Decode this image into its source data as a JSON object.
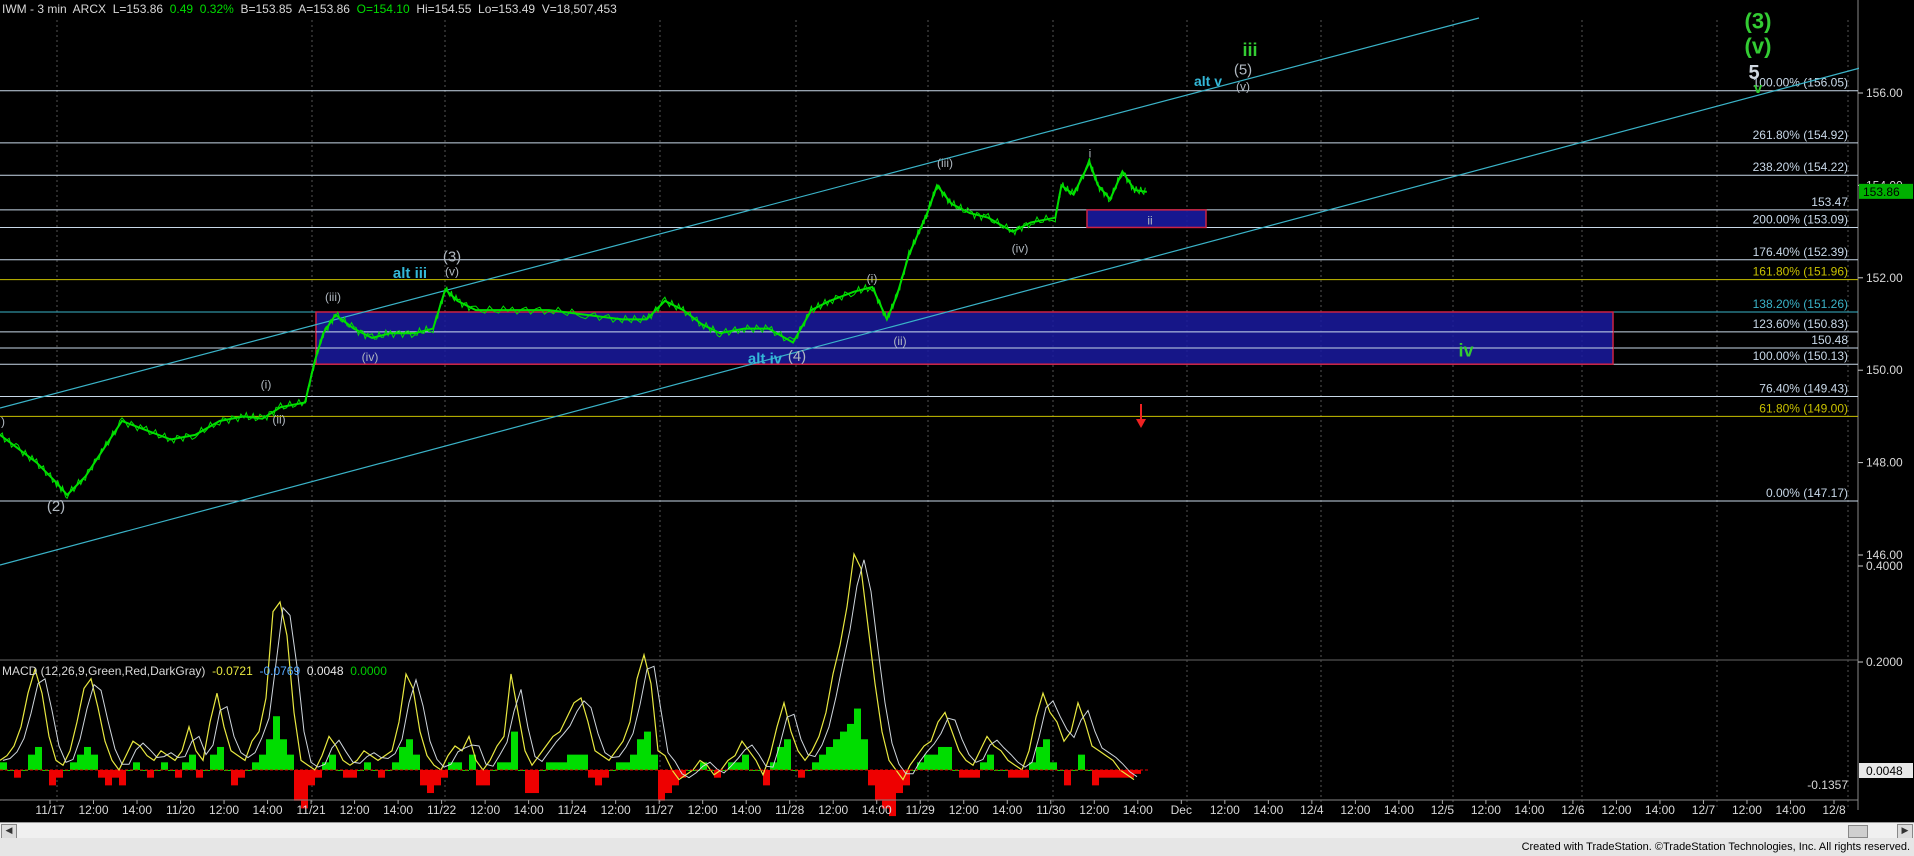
{
  "header": {
    "symbol": "IWM - 3 min  ARCX",
    "last": "L=153.86",
    "chg": "0.49",
    "chg_pct": "0.32%",
    "bid": "B=153.85",
    "ask": "A=153.86",
    "open": "O=154.10",
    "hi": "Hi=154.55",
    "lo": "Lo=153.49",
    "vol": "V=18,507,453"
  },
  "macd_header": {
    "label": "MACD (12,26,9,Green,Red,DarkGray)",
    "v1": "-0.0721",
    "v2": "-0.0769",
    "v3": "0.0048",
    "v4": "0.0000"
  },
  "colors": {
    "background": "#000000",
    "price": "#00e000",
    "channel": "#3ab3c8",
    "fib_line": "#c8d8e8",
    "box_fill": "#1a1aa0",
    "box_border": "#cc2244",
    "green_label": "#33cc33",
    "cyan_label": "#33b8d8",
    "gray_label": "#b0b8c0",
    "macd_line": "#e8e8e8",
    "signal_line": "#e8e840",
    "hist_pos": "#00dd00",
    "hist_neg": "#ee0000",
    "last_price_bg": "#00b000"
  },
  "chart_data": {
    "type": "line",
    "title": "IWM - 3 min  ARCX",
    "price_axis": {
      "min": 144,
      "max": 157.5,
      "ticks": [
        "156.00",
        "154.00",
        "152.00",
        "150.00",
        "148.00",
        "146.00"
      ]
    },
    "macd_axis": {
      "min": -0.2,
      "max": 0.55,
      "ticks": [
        "0.4000",
        "0.2000"
      ],
      "last_label": "-0.1357"
    },
    "x_ticks": [
      "11/17",
      "12:00",
      "14:00",
      "11/20",
      "12:00",
      "14:00",
      "11/21",
      "12:00",
      "14:00",
      "11/22",
      "12:00",
      "14:00",
      "11/24",
      "12:00",
      "11/27",
      "12:00",
      "14:00",
      "11/28",
      "12:00",
      "14:00",
      "11/29",
      "12:00",
      "14:00",
      "11/30",
      "12:00",
      "14:00",
      "Dec",
      "12:00",
      "14:00",
      "12/4",
      "12:00",
      "14:00",
      "12/5",
      "12:00",
      "14:00",
      "12/6",
      "12:00",
      "14:00",
      "12/7",
      "12:00",
      "14:00",
      "12/8"
    ],
    "last_price": "153.86",
    "last_macd": "0.0048",
    "price_series": [
      {
        "x": 0,
        "y": 148.6
      },
      {
        "x": 15,
        "y": 148.3
      },
      {
        "x": 30,
        "y": 148.0
      },
      {
        "x": 45,
        "y": 147.6
      },
      {
        "x": 55,
        "y": 147.3
      },
      {
        "x": 70,
        "y": 147.7
      },
      {
        "x": 85,
        "y": 148.3
      },
      {
        "x": 100,
        "y": 148.9
      },
      {
        "x": 120,
        "y": 148.7
      },
      {
        "x": 140,
        "y": 148.5
      },
      {
        "x": 160,
        "y": 148.6
      },
      {
        "x": 180,
        "y": 148.9
      },
      {
        "x": 200,
        "y": 149.0
      },
      {
        "x": 215,
        "y": 148.95
      },
      {
        "x": 230,
        "y": 149.2
      },
      {
        "x": 250,
        "y": 149.3
      },
      {
        "x": 258,
        "y": 150.2
      },
      {
        "x": 265,
        "y": 150.8
      },
      {
        "x": 275,
        "y": 151.2
      },
      {
        "x": 290,
        "y": 150.9
      },
      {
        "x": 305,
        "y": 150.7
      },
      {
        "x": 320,
        "y": 150.8
      },
      {
        "x": 340,
        "y": 150.8
      },
      {
        "x": 355,
        "y": 150.9
      },
      {
        "x": 365,
        "y": 151.75
      },
      {
        "x": 375,
        "y": 151.5
      },
      {
        "x": 390,
        "y": 151.3
      },
      {
        "x": 420,
        "y": 151.3
      },
      {
        "x": 450,
        "y": 151.3
      },
      {
        "x": 480,
        "y": 151.2
      },
      {
        "x": 510,
        "y": 151.1
      },
      {
        "x": 530,
        "y": 151.1
      },
      {
        "x": 545,
        "y": 151.5
      },
      {
        "x": 560,
        "y": 151.3
      },
      {
        "x": 575,
        "y": 151.0
      },
      {
        "x": 590,
        "y": 150.8
      },
      {
        "x": 610,
        "y": 150.9
      },
      {
        "x": 630,
        "y": 150.9
      },
      {
        "x": 650,
        "y": 150.6
      },
      {
        "x": 665,
        "y": 151.3
      },
      {
        "x": 680,
        "y": 151.5
      },
      {
        "x": 700,
        "y": 151.7
      },
      {
        "x": 715,
        "y": 151.8
      },
      {
        "x": 727,
        "y": 151.1
      },
      {
        "x": 735,
        "y": 151.6
      },
      {
        "x": 745,
        "y": 152.5
      },
      {
        "x": 755,
        "y": 153.1
      },
      {
        "x": 760,
        "y": 153.4
      },
      {
        "x": 768,
        "y": 154.0
      },
      {
        "x": 780,
        "y": 153.6
      },
      {
        "x": 795,
        "y": 153.4
      },
      {
        "x": 810,
        "y": 153.3
      },
      {
        "x": 830,
        "y": 153.0
      },
      {
        "x": 845,
        "y": 153.2
      },
      {
        "x": 865,
        "y": 153.3
      },
      {
        "x": 870,
        "y": 154.0
      },
      {
        "x": 880,
        "y": 153.8
      },
      {
        "x": 893,
        "y": 154.5
      },
      {
        "x": 900,
        "y": 154.0
      },
      {
        "x": 910,
        "y": 153.7
      },
      {
        "x": 920,
        "y": 154.3
      },
      {
        "x": 930,
        "y": 153.9
      },
      {
        "x": 940,
        "y": 153.86
      }
    ]
  },
  "fib_levels": [
    {
      "price": 156.05,
      "label": "100.00% (156.05)",
      "color": "#c8d8e8"
    },
    {
      "price": 154.92,
      "label": "261.80% (154.92)",
      "color": "#c8d8e8"
    },
    {
      "price": 154.22,
      "label": "238.20% (154.22)",
      "color": "#c8d8e8"
    },
    {
      "price": 153.47,
      "label": "153.47",
      "color": "#c8d8e8"
    },
    {
      "price": 153.09,
      "label": "200.00% (153.09)",
      "color": "#c8d8e8"
    },
    {
      "price": 152.39,
      "label": "176.40% (152.39)",
      "color": "#c8d8e8"
    },
    {
      "price": 151.96,
      "label": "161.80% (151.96)",
      "color": "#c8c000"
    },
    {
      "price": 151.26,
      "label": "138.20% (151.26)",
      "color": "#3ab3c8"
    },
    {
      "price": 150.83,
      "label": "123.60% (150.83)",
      "color": "#c8d8e8"
    },
    {
      "price": 150.48,
      "label": "150.48",
      "color": "#c8d8e8"
    },
    {
      "price": 150.13,
      "label": "100.00% (150.13)",
      "color": "#c8d8e8"
    },
    {
      "price": 149.43,
      "label": "76.40% (149.43)",
      "color": "#c8d8e8"
    },
    {
      "price": 149.0,
      "label": "61.80% (149.00)",
      "color": "#c8c000"
    },
    {
      "price": 147.17,
      "label": "0.00% (147.17)",
      "color": "#c8d8e8"
    }
  ],
  "wave_labels": [
    {
      "t": "(3)",
      "p": 157.4,
      "x": 1758,
      "c": "#33cc33",
      "s": 22
    },
    {
      "t": "(v)",
      "p": 156.85,
      "x": 1758,
      "c": "#33cc33",
      "s": 22
    },
    {
      "t": "5",
      "p": 156.3,
      "x": 1754,
      "c": "#d0d8e0",
      "s": 20
    },
    {
      "t": "v",
      "p": 156.0,
      "x": 1758,
      "c": "#33cc33",
      "s": 15
    },
    {
      "t": "iii",
      "p": 156.8,
      "x": 1250,
      "c": "#33cc33",
      "s": 18
    },
    {
      "t": "(5)",
      "p": 156.4,
      "x": 1243,
      "c": "#b0b8c0",
      "s": 15
    },
    {
      "t": "(v)",
      "p": 156.05,
      "x": 1243,
      "c": "#b0b8c0",
      "s": 12
    },
    {
      "t": "alt v",
      "p": 156.15,
      "x": 1208,
      "c": "#33b8d8",
      "s": 14
    },
    {
      "t": "i",
      "p": 154.6,
      "x": 1090,
      "c": "#b0b8c0",
      "s": 12
    },
    {
      "t": "(iii)",
      "p": 154.4,
      "x": 945,
      "c": "#b0b8c0",
      "s": 12
    },
    {
      "t": "ii",
      "p": 153.15,
      "x": 1150,
      "c": "#b0b8c0",
      "s": 12
    },
    {
      "t": "(iv)",
      "p": 152.55,
      "x": 1020,
      "c": "#b0b8c0",
      "s": 12
    },
    {
      "t": "(i)",
      "p": 151.9,
      "x": 872,
      "c": "#b0b8c0",
      "s": 12
    },
    {
      "t": "(ii)",
      "p": 150.55,
      "x": 900,
      "c": "#b0b8c0",
      "s": 12
    },
    {
      "t": "alt iii",
      "p": 152.0,
      "x": 410,
      "c": "#33b8d8",
      "s": 15
    },
    {
      "t": "(3)",
      "p": 152.35,
      "x": 452,
      "c": "#b0b8c0",
      "s": 15
    },
    {
      "t": "(v)",
      "p": 152.05,
      "x": 452,
      "c": "#b0b8c0",
      "s": 12
    },
    {
      "t": "(iii)",
      "p": 151.5,
      "x": 333,
      "c": "#b0b8c0",
      "s": 12
    },
    {
      "t": "(iv)",
      "p": 150.2,
      "x": 370,
      "c": "#b0b8c0",
      "s": 12
    },
    {
      "t": "alt iv",
      "p": 150.15,
      "x": 765,
      "c": "#33b8d8",
      "s": 15
    },
    {
      "t": "(4)",
      "p": 150.2,
      "x": 797,
      "c": "#b0b8c0",
      "s": 15
    },
    {
      "t": "iv",
      "p": 150.3,
      "x": 1466,
      "c": "#33cc33",
      "s": 18
    },
    {
      "t": "(i)",
      "p": 149.6,
      "x": 266,
      "c": "#b0b8c0",
      "s": 12
    },
    {
      "t": "(ii)",
      "p": 148.85,
      "x": 279,
      "c": "#b0b8c0",
      "s": 12
    },
    {
      "t": "(2)",
      "p": 146.95,
      "x": 56,
      "c": "#b0b8c0",
      "s": 15
    },
    {
      "t": ")",
      "p": 148.8,
      "x": 3,
      "c": "#b0b8c0",
      "s": 12
    }
  ],
  "macd_series": {
    "macd": [
      0.02,
      0.03,
      0.05,
      0.09,
      0.16,
      0.21,
      0.16,
      0.07,
      0.02,
      0.01,
      0.04,
      0.1,
      0.17,
      0.19,
      0.13,
      0.06,
      0.02,
      0.0,
      0.03,
      0.06,
      0.05,
      0.03,
      0.02,
      0.04,
      0.03,
      0.02,
      0.04,
      0.09,
      0.04,
      0.02,
      0.1,
      0.16,
      0.09,
      0.04,
      0.03,
      0.02,
      0.06,
      0.08,
      0.15,
      0.33,
      0.35,
      0.28,
      0.12,
      0.02,
      0.01,
      0.0,
      0.03,
      0.07,
      0.05,
      0.02,
      0.01,
      0.02,
      0.04,
      0.03,
      0.02,
      0.03,
      0.04,
      0.1,
      0.2,
      0.17,
      0.08,
      0.03,
      0.01,
      0.0,
      0.03,
      0.05,
      0.04,
      0.07,
      0.02,
      0.0,
      0.02,
      0.05,
      0.07,
      0.2,
      0.12,
      0.04,
      0.01,
      0.03,
      0.05,
      0.07,
      0.08,
      0.11,
      0.14,
      0.15,
      0.1,
      0.04,
      0.03,
      0.02,
      0.04,
      0.06,
      0.1,
      0.19,
      0.24,
      0.18,
      0.04,
      0.03,
      0.0,
      -0.02,
      -0.01,
      0.0,
      0.02,
      0.01,
      -0.01,
      0.0,
      0.02,
      0.03,
      0.06,
      0.04,
      0.02,
      -0.01,
      0.03,
      0.09,
      0.14,
      0.08,
      0.04,
      0.02,
      0.04,
      0.07,
      0.12,
      0.2,
      0.26,
      0.34,
      0.45,
      0.42,
      0.3,
      0.18,
      0.08,
      0.02,
      0.0,
      -0.02,
      0.01,
      0.03,
      0.05,
      0.06,
      0.1,
      0.12,
      0.08,
      0.04,
      0.02,
      0.01,
      0.04,
      0.07,
      0.05,
      0.04,
      0.02,
      0.01,
      0.0,
      0.04,
      0.11,
      0.16,
      0.12,
      0.1,
      0.06,
      0.08,
      0.14,
      0.1,
      0.05,
      0.04,
      0.03,
      0.02,
      0.0,
      -0.01,
      -0.02
    ],
    "hist": [
      0.01,
      0.0,
      -0.01,
      0.0,
      0.02,
      0.03,
      0.0,
      -0.02,
      -0.01,
      0.0,
      0.01,
      0.02,
      0.03,
      0.02,
      -0.01,
      -0.02,
      -0.01,
      -0.02,
      0.0,
      0.01,
      0.0,
      -0.01,
      0.0,
      0.01,
      0.0,
      -0.01,
      0.01,
      0.02,
      -0.01,
      0.0,
      0.02,
      0.03,
      0.0,
      -0.02,
      -0.01,
      0.0,
      0.01,
      0.02,
      0.04,
      0.07,
      0.04,
      0.02,
      -0.04,
      -0.05,
      -0.02,
      -0.01,
      0.01,
      0.02,
      0.0,
      -0.01,
      -0.01,
      0.0,
      0.01,
      0.0,
      -0.01,
      0.0,
      0.01,
      0.03,
      0.04,
      0.02,
      -0.02,
      -0.03,
      -0.02,
      -0.01,
      0.01,
      0.01,
      0.0,
      0.02,
      -0.02,
      -0.02,
      0.0,
      0.01,
      0.01,
      0.05,
      0.0,
      -0.03,
      -0.03,
      0.0,
      0.01,
      0.01,
      0.01,
      0.02,
      0.02,
      0.02,
      -0.01,
      -0.02,
      -0.01,
      0.0,
      0.01,
      0.01,
      0.02,
      0.04,
      0.05,
      0.02,
      -0.04,
      -0.03,
      -0.02,
      -0.01,
      0.0,
      0.0,
      0.01,
      0.0,
      -0.01,
      0.0,
      0.01,
      0.01,
      0.02,
      0.0,
      0.0,
      -0.02,
      0.01,
      0.03,
      0.04,
      0.0,
      -0.01,
      0.0,
      0.01,
      0.02,
      0.03,
      0.04,
      0.05,
      0.06,
      0.08,
      0.04,
      -0.02,
      -0.04,
      -0.05,
      -0.06,
      -0.03,
      -0.02,
      0.0,
      0.01,
      0.02,
      0.02,
      0.03,
      0.03,
      0.0,
      -0.01,
      -0.01,
      -0.01,
      0.01,
      0.02,
      0.0,
      0.0,
      -0.01,
      -0.01,
      -0.01,
      0.01,
      0.03,
      0.04,
      0.01,
      0.0,
      -0.02,
      0.0,
      0.02,
      0.0,
      -0.02,
      -0.01,
      -0.01,
      -0.01,
      -0.01,
      -0.01,
      -0.005
    ]
  },
  "credit": "Created with TradeStation. ©TradeStation Technologies, Inc. All rights reserved."
}
